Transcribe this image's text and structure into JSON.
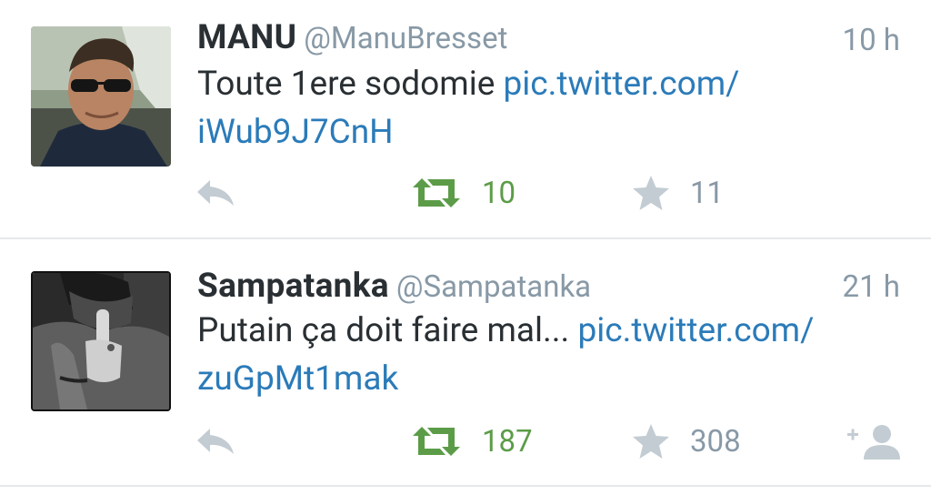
{
  "tweets": [
    {
      "name": "MANU",
      "handle": "@ManuBresset",
      "time": "10 h",
      "text": "Toute 1ere sodomie ",
      "link_part1": "pic.twitter.com/",
      "link_part2": "iWub9J7CnH",
      "retweets": "10",
      "favorites": "11",
      "icons": [
        "reply-icon",
        "retweet-icon",
        "star-icon"
      ]
    },
    {
      "name": "Sampatanka",
      "handle": "@Sampatanka",
      "time": "21 h",
      "text": "Putain ça doit faire mal... ",
      "link_part1": "pic.twitter.com/",
      "link_part2": "zuGpMt1mak",
      "retweets": "187",
      "favorites": "308",
      "icons": [
        "reply-icon",
        "retweet-icon",
        "star-icon",
        "follow-icon"
      ]
    }
  ],
  "colors": {
    "link": "#2b7bb9",
    "retweet": "#5c9c48",
    "muted": "#8899a6",
    "icon": "#c3ccd3",
    "text": "#292f33"
  }
}
